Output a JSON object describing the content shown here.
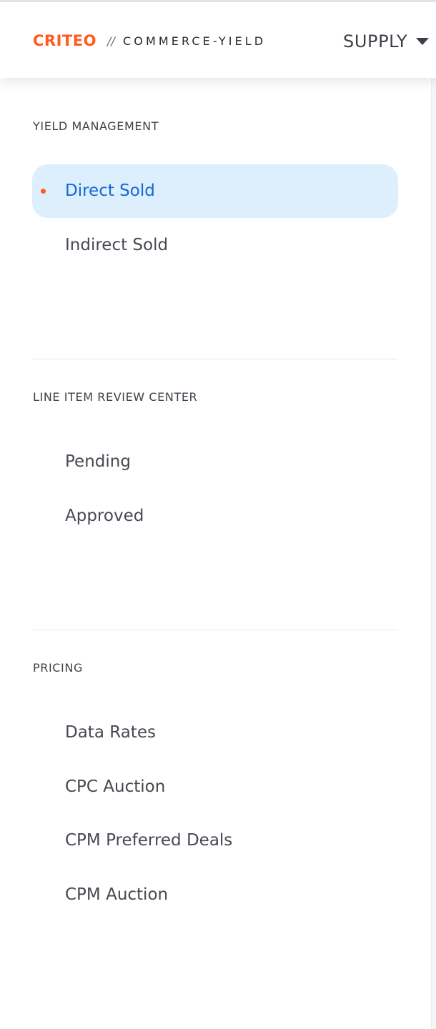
{
  "header": {
    "brand": "CRITEO",
    "separator": "//",
    "product": "COMMERCE-YIELD",
    "menu_label": "SUPPLY",
    "menu_icon": "caret-down-icon",
    "brand_color": "#ff5a1f"
  },
  "sidebar": {
    "sections": [
      {
        "title": "YIELD MANAGEMENT",
        "items": [
          {
            "label": "Direct Sold",
            "active": true
          },
          {
            "label": "Indirect Sold",
            "active": false
          }
        ]
      },
      {
        "title": "LINE ITEM REVIEW CENTER",
        "items": [
          {
            "label": "Pending",
            "active": false
          },
          {
            "label": "Approved",
            "active": false
          }
        ]
      },
      {
        "title": "PRICING",
        "items": [
          {
            "label": "Data Rates",
            "active": false
          },
          {
            "label": "CPC Auction",
            "active": false
          },
          {
            "label": "CPM Preferred Deals",
            "active": false
          },
          {
            "label": "CPM Auction",
            "active": false
          }
        ]
      }
    ]
  },
  "colors": {
    "accent": "#1667d6",
    "active_background": "#ddeefc",
    "active_dot": "#ff5a1f"
  }
}
